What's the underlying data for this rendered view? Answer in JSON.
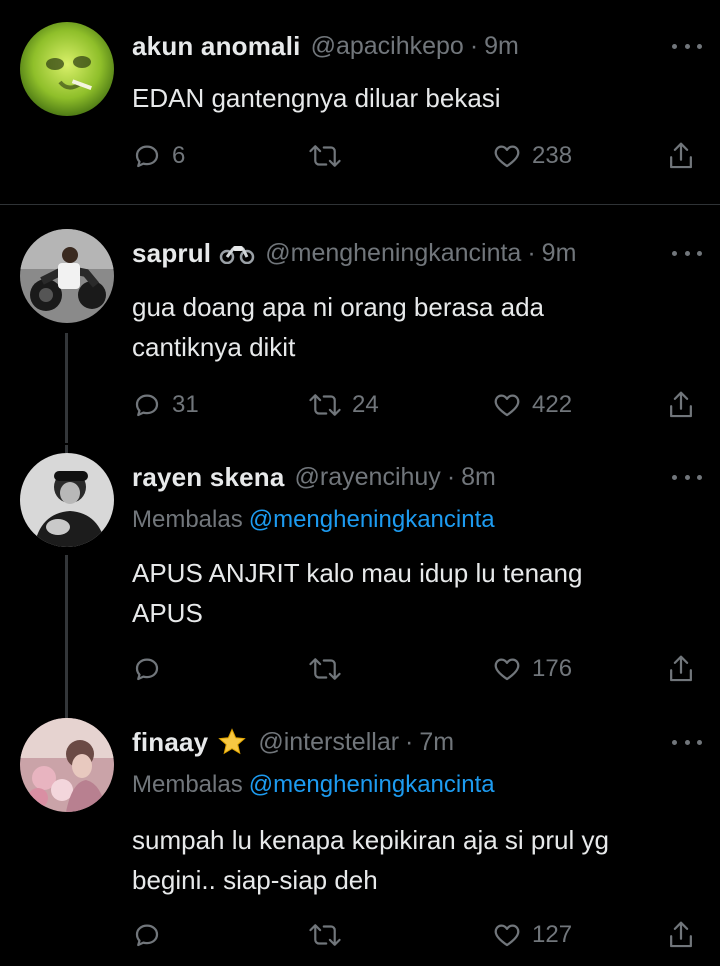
{
  "tweets": [
    {
      "name": "akun anomali",
      "handle": "@apacihkepo",
      "dot": "·",
      "time": "9m",
      "reply_prefix": "",
      "reply_mention": "",
      "lines": [
        "EDAN gantengnya diluar bekasi"
      ],
      "replies": "6",
      "retweets": "",
      "likes": "238",
      "avatar_icon": "green-face-avatar"
    },
    {
      "name": "saprul",
      "badge": "motorcycle-emoji",
      "handle": "@mengheningkancinta",
      "dot": "·",
      "time": "9m",
      "reply_prefix": "",
      "reply_mention": "",
      "lines": [
        "gua doang apa ni orang berasa ada",
        "cantiknya dikit"
      ],
      "replies": "31",
      "retweets": "24",
      "likes": "422",
      "avatar_icon": "motorcycle-photo-avatar"
    },
    {
      "name": "rayen skena",
      "handle": "@rayencihuy",
      "dot": "·",
      "time": "8m",
      "reply_prefix": "Membalas",
      "reply_mention": "@mengheningkancinta",
      "lines": [
        "APUS ANJRIT kalo mau idup lu tenang",
        "APUS"
      ],
      "replies": "",
      "retweets": "",
      "likes": "176",
      "avatar_icon": "bw-photo-avatar"
    },
    {
      "name": "finaay",
      "badge": "star-emoji",
      "handle": "@interstellar",
      "dot": "·",
      "time": "7m",
      "reply_prefix": "Membalas",
      "reply_mention": "@mengheningkancinta",
      "lines": [
        "sumpah lu kenapa kepikiran aja si prul yg",
        "begini.. siap-siap deh"
      ],
      "replies": "",
      "retweets": "",
      "likes": "127",
      "avatar_icon": "pink-flowers-avatar"
    }
  ],
  "colors": {
    "background": "#000000",
    "text": "#e7e9ea",
    "muted": "#71767b",
    "link": "#1d9bf0",
    "divider": "#2f3336"
  }
}
